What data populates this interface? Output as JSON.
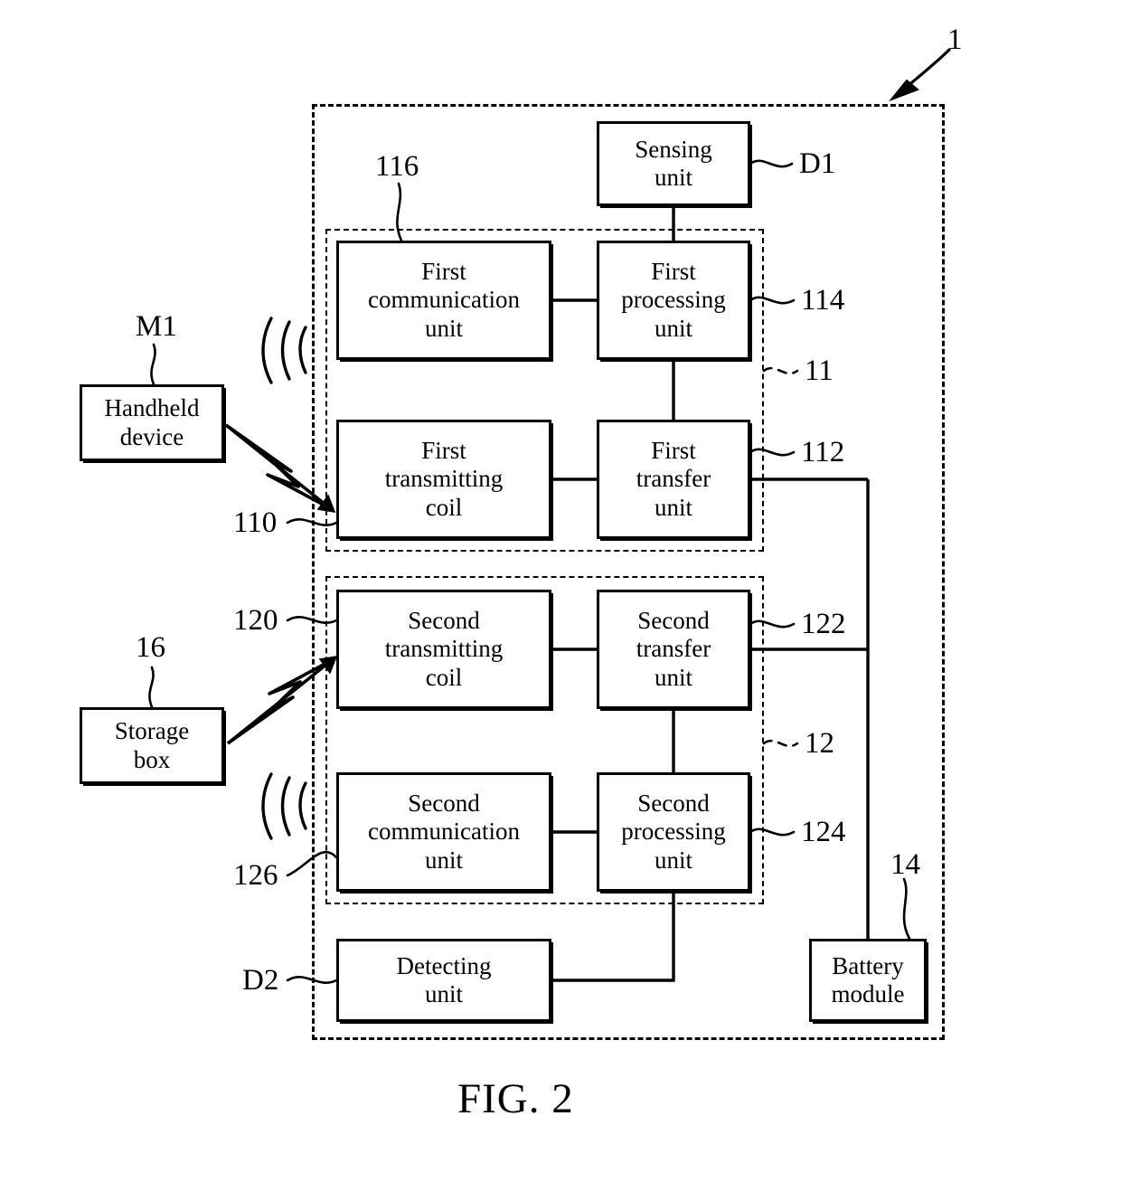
{
  "figure": {
    "caption": "FIG. 2",
    "system_ref": "1"
  },
  "external_devices": [
    {
      "id": "handheld-device",
      "label": "Handheld\ndevice",
      "ref": "M1"
    },
    {
      "id": "storage-box",
      "label": "Storage\nbox",
      "ref": "16"
    }
  ],
  "system": {
    "sensing_unit": {
      "label": "Sensing\nunit",
      "ref": "D1"
    },
    "detecting_unit": {
      "label": "Detecting\nunit",
      "ref": "D2"
    },
    "battery_module": {
      "label": "Battery\nmodule",
      "ref": "14"
    },
    "first_module": {
      "ref": "11",
      "units": [
        {
          "id": "first-communication-unit",
          "label": "First\ncommunication\nunit",
          "ref": "116"
        },
        {
          "id": "first-processing-unit",
          "label": "First\nprocessing\nunit",
          "ref": "114"
        },
        {
          "id": "first-transmitting-coil",
          "label": "First\ntransmitting\ncoil",
          "ref": "110"
        },
        {
          "id": "first-transfer-unit",
          "label": "First\ntransfer\nunit",
          "ref": "112"
        }
      ]
    },
    "second_module": {
      "ref": "12",
      "units": [
        {
          "id": "second-transmitting-coil",
          "label": "Second\ntransmitting\ncoil",
          "ref": "120"
        },
        {
          "id": "second-transfer-unit",
          "label": "Second\ntransfer\nunit",
          "ref": "122"
        },
        {
          "id": "second-communication-unit",
          "label": "Second\ncommunication\nunit",
          "ref": "126"
        },
        {
          "id": "second-processing-unit",
          "label": "Second\nprocessing\nunit",
          "ref": "124"
        }
      ]
    }
  },
  "style": {
    "line_color": "#000000",
    "background": "#ffffff"
  }
}
